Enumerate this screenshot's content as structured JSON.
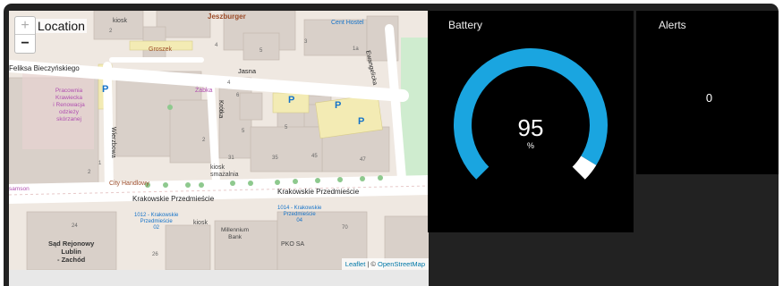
{
  "map": {
    "title": "Location",
    "zoom_in": "+",
    "zoom_out": "−",
    "attribution": {
      "leaflet": "Leaflet",
      "separator": " | © ",
      "osm": "OpenStreetMap"
    },
    "labels": {
      "jeszburger": "Jeszburger",
      "kiosk_top": "kiosk",
      "cent_hostel": "Cent Hostel",
      "groszek": "Groszek",
      "feliksa": "Feliksa Bieczyńskiego",
      "jasna": "Jasna",
      "ewangelicka": "Ewangelicka",
      "pracownia": [
        "Pracownia",
        "Krawiecka",
        "i Renowacja",
        "odzieży",
        "skórzanej"
      ],
      "zabka": "Żabka",
      "krotka": "Krótka",
      "wierzbowa": "Wierzbowa",
      "kiosk_smazalnia": [
        "kiosk",
        "smażalnia"
      ],
      "city_handlowy": "City Handlowy",
      "krakowskie_left": "Krakowskie Przedmieście",
      "krakowskie_right": "Krakowskie Przedmieście",
      "stop_1012": [
        "1012 - Krakowskie",
        "Przedmieście",
        "02"
      ],
      "kiosk_bottom": "kiosk",
      "millennium": [
        "Millennium",
        "Bank"
      ],
      "stop_1014": [
        "1014 - Krakowskie",
        "Przedmieście",
        "04"
      ],
      "pko": "PKO SA",
      "sad": [
        "Sąd Rejonowy",
        "Lublin",
        "- Zachód"
      ],
      "samson": "samson",
      "parking": "P",
      "numbers": [
        "2",
        "4",
        "5",
        "3",
        "1a",
        "4",
        "6",
        "5",
        "5",
        "2",
        "31",
        "35",
        "45",
        "47",
        "2",
        "1",
        "70",
        "24",
        "26"
      ]
    }
  },
  "battery": {
    "title": "Battery",
    "value": "95",
    "unit": "%",
    "percent": 95,
    "accent": "#1aa5e0"
  },
  "alerts": {
    "title": "Alerts",
    "value": "0"
  },
  "colors": {
    "frame": "#222222",
    "widget_bg": "#000000",
    "map_bg": "#efe8e1",
    "building": "#d9d0c9",
    "road": "#ffffff"
  }
}
